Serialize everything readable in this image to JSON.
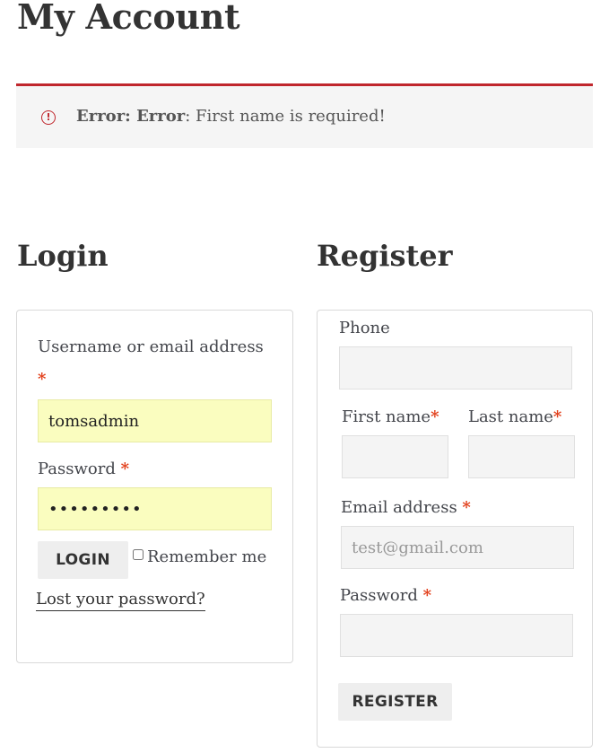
{
  "page": {
    "title": "My Account"
  },
  "notice": {
    "prefix": "Error: Error",
    "message": ": First name is required!",
    "icon": "alert-circle-icon",
    "accent_color": "#c0272d"
  },
  "login": {
    "heading": "Login",
    "username_label": "Username or email address",
    "username_value": "tomsadmin",
    "password_label": "Password",
    "password_value": "•••••••••",
    "login_button": "LOGIN",
    "remember_label": "Remember me",
    "lost_password": "Lost your password?"
  },
  "register": {
    "heading": "Register",
    "phone_label": "Phone",
    "first_name_label": "First name",
    "last_name_label": "Last name",
    "email_label": "Email address",
    "email_placeholder": "test@gmail.com",
    "password_label": "Password",
    "register_button": "REGISTER"
  },
  "required_marker": "*"
}
